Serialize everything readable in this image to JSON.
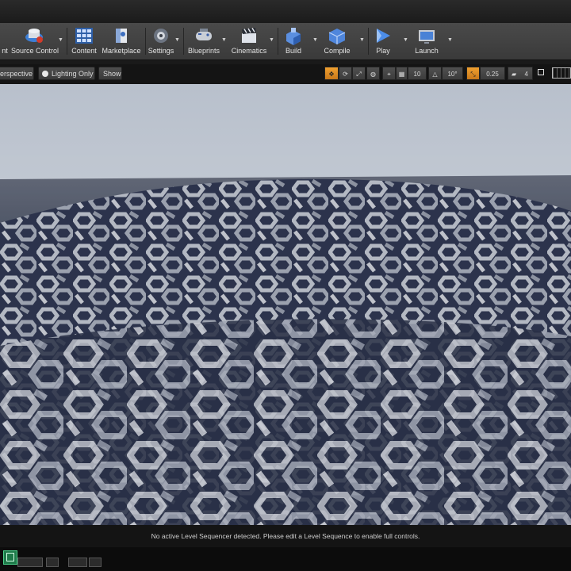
{
  "toolbar": {
    "items": [
      {
        "label": "nt",
        "icon": "save-icon"
      },
      {
        "label": "Source Control",
        "icon": "source-control-icon"
      },
      {
        "label": "Content",
        "icon": "content-icon"
      },
      {
        "label": "Marketplace",
        "icon": "marketplace-icon"
      },
      {
        "label": "Settings",
        "icon": "settings-icon"
      },
      {
        "label": "Blueprints",
        "icon": "blueprints-icon"
      },
      {
        "label": "Cinematics",
        "icon": "cinematics-icon"
      },
      {
        "label": "Build",
        "icon": "build-icon"
      },
      {
        "label": "Compile",
        "icon": "compile-icon"
      },
      {
        "label": "Play",
        "icon": "play-icon"
      },
      {
        "label": "Launch",
        "icon": "launch-icon"
      }
    ]
  },
  "viewport_toolbar": {
    "view_mode": "erspective",
    "lighting": "Lighting Only",
    "show": "Show",
    "grid_snap": "10",
    "rotation_snap": "10°",
    "scale_snap": "0.25",
    "camera_speed": "4"
  },
  "status": {
    "message": "No active Level Sequencer detected. Please edit a Level Sequence to enable full controls."
  },
  "colors": {
    "accent": "#e8962a",
    "toolbar_bg": "#404040"
  }
}
